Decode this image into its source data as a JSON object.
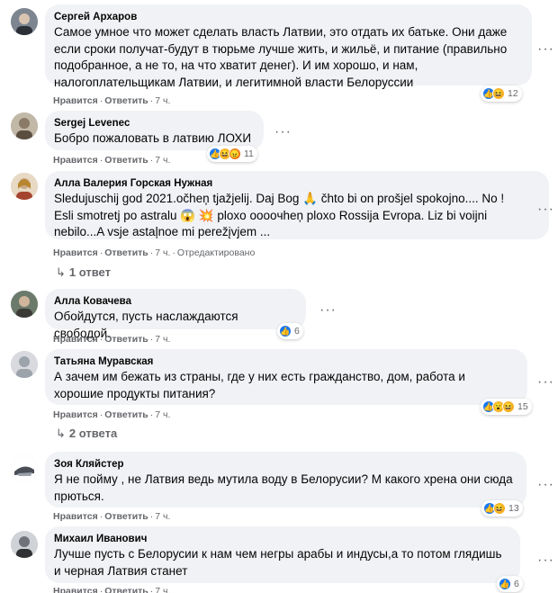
{
  "action_like": "Нравится",
  "action_reply": "Ответить",
  "separator": "·",
  "edited_label": "Отредактировано",
  "more_glyph": "···",
  "comments": [
    {
      "author": "Сергей Архаров",
      "lines": [
        "Самое умное что может сделать власть Латвии, это отдать их батьке. Они даже",
        "если сроки получат-будут в тюрьме лучше жить, и жильё, и питание (правильно",
        "подобранное, а не то, на что хватит денег). И им хорошо, и нам,",
        "налогоплательщикам Латвии, и легитимной власти Белоруссии"
      ],
      "time": "7 ч.",
      "reactions": [
        "like",
        "haha"
      ],
      "reaction_count": "12"
    },
    {
      "author": "Sergej Levenec",
      "lines": [
        "Бобро пожаловать в латвию ЛОХИ"
      ],
      "time": "7 ч.",
      "reactions": [
        "like",
        "haha",
        "angry"
      ],
      "reaction_count": "11"
    },
    {
      "author": "Алла Валерия Горская Нужная",
      "lines": [
        "Sledujuschij god 2021.očheņ tjažjelij. Daj Bog 🙏 čhto bi on prošjel spokojno.... No !",
        "Esli smotretj po astralu 😱 💥 ploxo ooooчheņ ploxo Rossija Evropa. Liz bi voijni",
        "nebilo...A vsje astaļnoe mi perežįvjem ..."
      ],
      "time": "7 ч.",
      "edited": true,
      "replies": "1 ответ"
    },
    {
      "author": "Алла Ковачева",
      "lines": [
        "Обойдутся, пусть наслаждаются свободой."
      ],
      "time": "7 ч.",
      "reactions": [
        "like"
      ],
      "reaction_count": "6"
    },
    {
      "author": "Татьяна Муравская",
      "lines": [
        "А зачем им бежать из страны, где у них есть гражданство, дом, работа и",
        "хорошие продукты питания?"
      ],
      "time": "7 ч.",
      "reactions": [
        "like",
        "wow",
        "haha"
      ],
      "reaction_count": "15",
      "replies": "2 ответа"
    },
    {
      "author": "Зоя Кляйстер",
      "lines": [
        "Я не пойму , не Латвия ведь мутила воду в Белорусии? М какого хрена они сюда",
        "прються."
      ],
      "time": "7 ч.",
      "reactions": [
        "like",
        "haha"
      ],
      "reaction_count": "13"
    },
    {
      "author": "Михаил Иванович",
      "lines": [
        "Лучше пусть с Белорусии к нам чем негры арабы и индусы,а то потом глядишь",
        "и черная Латвия станет"
      ],
      "time": "7 ч.",
      "reactions": [
        "like"
      ],
      "reaction_count": "6"
    }
  ],
  "colors": {
    "bubble": "#f0f2f5",
    "meta": "#65676b",
    "like": "#1877f2",
    "haha": "#f7b125",
    "angry": "#e9710f"
  }
}
